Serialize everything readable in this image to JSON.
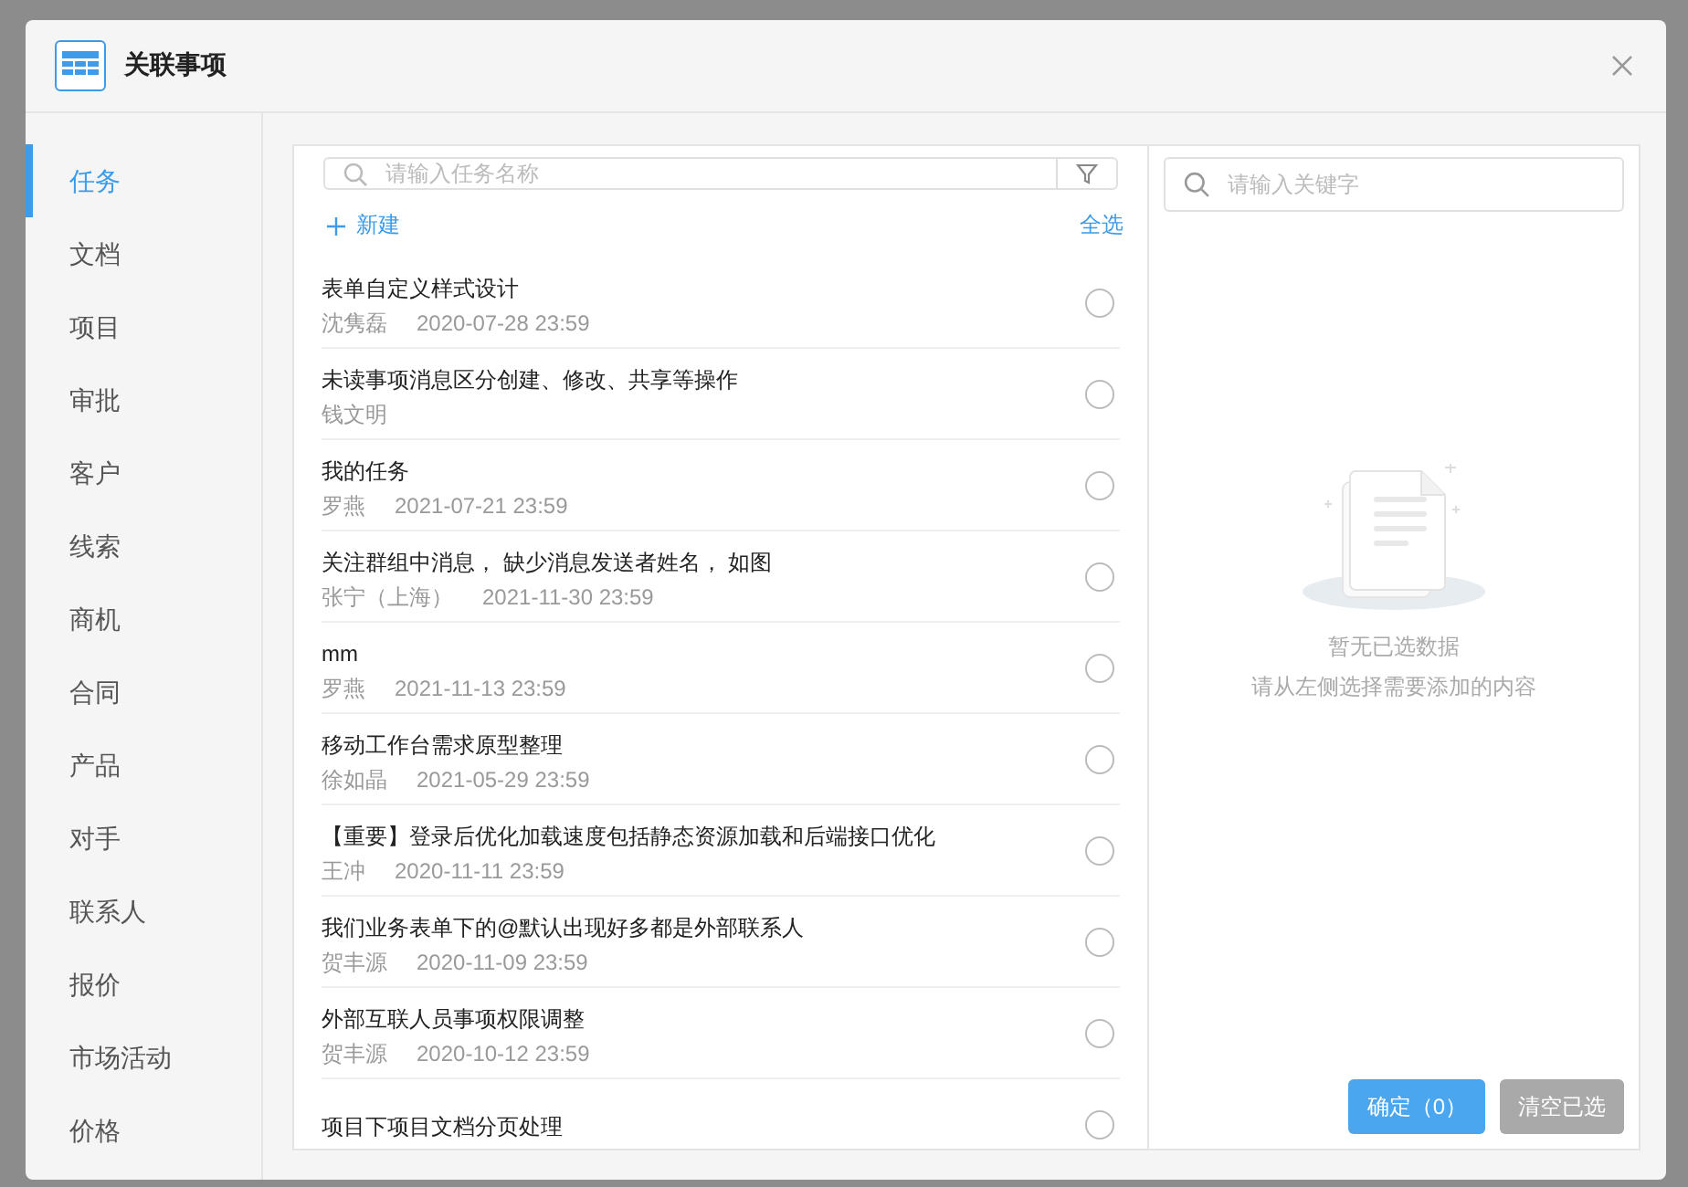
{
  "dialog": {
    "title": "关联事项"
  },
  "sidebar": {
    "items": [
      {
        "label": "任务",
        "selected": true
      },
      {
        "label": "文档",
        "selected": false
      },
      {
        "label": "项目",
        "selected": false
      },
      {
        "label": "审批",
        "selected": false
      },
      {
        "label": "客户",
        "selected": false
      },
      {
        "label": "线索",
        "selected": false
      },
      {
        "label": "商机",
        "selected": false
      },
      {
        "label": "合同",
        "selected": false
      },
      {
        "label": "产品",
        "selected": false
      },
      {
        "label": "对手",
        "selected": false
      },
      {
        "label": "联系人",
        "selected": false
      },
      {
        "label": "报价",
        "selected": false
      },
      {
        "label": "市场活动",
        "selected": false
      },
      {
        "label": "价格",
        "selected": false
      }
    ]
  },
  "task_list": {
    "search": {
      "placeholder": "请输入任务名称"
    },
    "new_label": "新建",
    "select_all_label": "全选",
    "items": [
      {
        "title": "表单自定义样式设计",
        "owner": "沈隽磊",
        "due": "2020-07-28 23:59",
        "selected": false
      },
      {
        "title": "未读事项消息区分创建、修改、共享等操作",
        "owner": "钱文明",
        "selected": false
      },
      {
        "title": "我的任务",
        "owner": "罗燕",
        "due": "2021-07-21 23:59",
        "selected": false
      },
      {
        "title": "关注群组中消息， 缺少消息发送者姓名， 如图",
        "owner": "张宁（上海）",
        "due": "2021-11-30 23:59",
        "selected": false
      },
      {
        "title": "mm",
        "owner": "罗燕",
        "due": "2021-11-13 23:59",
        "selected": false
      },
      {
        "title": "移动工作台需求原型整理",
        "owner": "徐如晶",
        "due": "2021-05-29 23:59",
        "selected": false
      },
      {
        "title": "【重要】登录后优化加载速度包括静态资源加载和后端接口优化",
        "owner": "王冲",
        "due": "2020-11-11 23:59",
        "selected": false
      },
      {
        "title": "我们业务表单下的@默认出现好多都是外部联系人",
        "owner": "贺丰源",
        "due": "2020-11-09 23:59",
        "selected": false
      },
      {
        "title": "外部互联人员事项权限调整",
        "owner": "贺丰源",
        "due": "2020-10-12 23:59",
        "selected": false
      },
      {
        "title": "项目下项目文档分页处理",
        "selected": false
      }
    ]
  },
  "selected_panel": {
    "search": {
      "placeholder": "请输入关键字"
    },
    "empty_title": "暂无已选数据",
    "empty_hint": "请从左侧选择需要添加的内容",
    "buttons": [
      {
        "label": "确定（0）",
        "kind": "primary",
        "disabled": false
      },
      {
        "label": "清空已选",
        "kind": "secondary",
        "disabled": true
      }
    ]
  }
}
